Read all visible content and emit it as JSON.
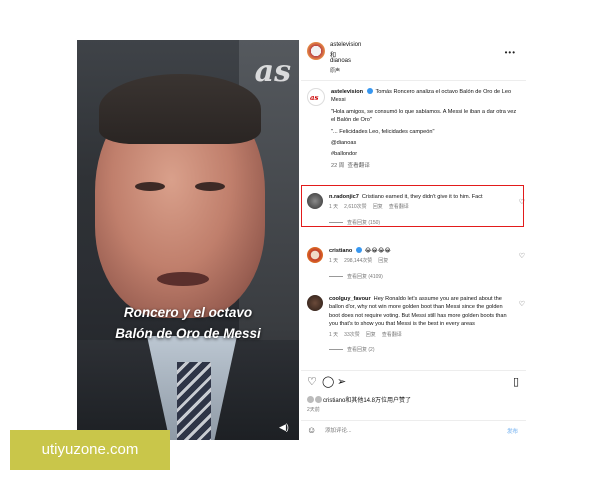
{
  "video": {
    "logo": "as",
    "caption_line1": "Roncero y el octavo",
    "caption_line2": "Balón de Oro de Messi",
    "volume_icon": "volume-icon"
  },
  "header": {
    "line1": "astelevision",
    "line2": "和",
    "line3": "dianoas",
    "line4": "原声",
    "more_icon": "more-icon"
  },
  "caption": {
    "username": "astelevision",
    "title": "Tomás Roncero analiza el octavo Balón de Oro de Leo Messi",
    "quote": "\"Hola amigos, se consumó lo que sabíamos. A Messi le iban a dar otra vez el Balón de Oro\"",
    "quote2": "\"... Felicidades Leo, felicidades campeón\"",
    "mention": "@dianoas",
    "hashtag": "#ballondor",
    "time": "22 周",
    "see_translation": "查看翻译"
  },
  "comments": [
    {
      "username": "n.radonjic7",
      "text": "Cristiano earned it, they didn't give it to him. Fact",
      "time": "1 天",
      "likes": "2,610次赞",
      "reply": "回复",
      "translate": "查看翻译",
      "replies": "查看回复 (150)"
    },
    {
      "username": "cristiano",
      "text": "😂😂😂😂",
      "time": "1 天",
      "likes": "298,144次赞",
      "reply": "回复",
      "translate": "",
      "replies": "查看回复 (4109)"
    },
    {
      "username": "coolguy_favour",
      "text": "Hey Ronaldo let's assume you are pained about the ballon d'or, why not win more golden boot than Messi since the golden boot does not require voting. But Messi still has more golden boots than you that's to show you that Messi is the best in every areas",
      "time": "1 天",
      "likes": "33次赞",
      "reply": "回复",
      "translate": "查看翻译",
      "replies": "查看回复 (2)"
    }
  ],
  "actions": {
    "like_icon": "heart-icon",
    "comment_icon": "comment-icon",
    "share_icon": "send-icon",
    "save_icon": "bookmark-icon"
  },
  "likes_line": "cristiano和其他14.8万位用户赞了",
  "ago": "2天前",
  "input": {
    "placeholder": "添加评论...",
    "post": "发布"
  },
  "watermark": "utiyuzone.com",
  "colors": {
    "highlight": "#e21b1b",
    "verified": "#3797f0",
    "watermark_bg": "#c9c64a"
  }
}
